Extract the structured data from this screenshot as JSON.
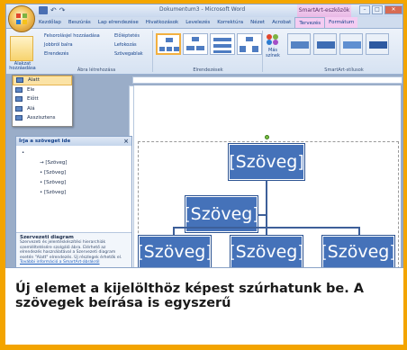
{
  "window": {
    "title": "Dokumentum3 - Microsoft Word",
    "context_title": "SmartArt-eszközök"
  },
  "tabs": [
    "Kezdőlap",
    "Beszúrás",
    "Lap elrendezése",
    "Hivatkozások",
    "Levelezés",
    "Korrektúra",
    "Nézet",
    "Acrobat",
    "Tervezés",
    "Formátum"
  ],
  "ribbon": {
    "add_shape": "Alakzat hozzáadása",
    "add_bullet": "Felsorolásjel hozzáadása",
    "right_to_left": "Jobbról balra",
    "layout": "Elrendezés",
    "promote": "Előléptetés",
    "demote": "Lefokozás",
    "text_pane": "Szövegablak",
    "group_create": "Ábra létrehozása",
    "group_layouts": "Elrendezések",
    "change_colors": "Más színek",
    "group_styles": "SmartArt-stílusok"
  },
  "menu": {
    "items": [
      "Alatt",
      "Ele",
      "Előtt",
      "Alá",
      "Asszisztens"
    ]
  },
  "text_pane": {
    "title": "Írja a szöveget ide",
    "bullets": [
      "[Szöveg]",
      "[Szöveg]",
      "[Szöveg]",
      "[Szöveg]"
    ],
    "desc_title": "Szervezeti diagram",
    "desc_text": "Szervezeti és jelentéskészítési hierarchiák szemléltetésére szolgáló ábra. Elérhető az elrendezés használatával a Szervezeti diagram esetén \"Alatt\" elrendezés. Új részlegek érhetők el.",
    "link": "További információ a SmartArt-ábrákról"
  },
  "smartart": {
    "boxes": [
      "[Szöveg]",
      "[Szöveg]",
      "[Szöveg]",
      "[Szöveg]",
      "[Szöveg]"
    ],
    "fill": "#4572b9"
  },
  "caption": {
    "text": "Új elemet a kijelölthöz képest szúrhatunk be. A szövegek beírása is egyszerű"
  },
  "colors": {
    "frame": "#f3a400"
  }
}
